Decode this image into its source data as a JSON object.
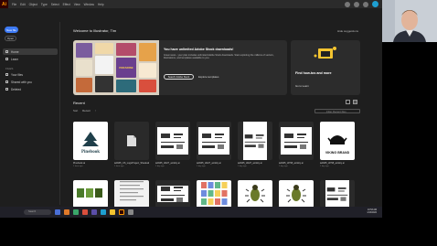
{
  "menubar": {
    "logo": "Ai",
    "items": [
      "File",
      "Edit",
      "Object",
      "Type",
      "Select",
      "Effect",
      "View",
      "Window",
      "Help"
    ]
  },
  "sidebar": {
    "new_file": "New file",
    "open": "Open",
    "items": [
      {
        "label": "Home",
        "icon": "home-icon"
      },
      {
        "label": "Learn",
        "icon": "lightbulb-icon"
      }
    ],
    "files_heading": "FILES",
    "file_items": [
      {
        "label": "Your files",
        "icon": "cloud-icon"
      },
      {
        "label": "Shared with you",
        "icon": "people-icon"
      },
      {
        "label": "Deleted",
        "icon": "trash-icon"
      }
    ]
  },
  "main": {
    "welcome": "Welcome to Illustrator, Tim",
    "hide_suggestions": "Hide suggestions",
    "promo": {
      "title": "You have unlimited Adobe Stock downloads!",
      "body": "Great news - your plan includes unlimited Adobe Stock downloads. Start exploring the millions of vectors, illustrations, and templates available to you.",
      "button": "Search Adobe Stock",
      "link": "Explore templates",
      "collage_text": "PARADISE"
    },
    "discover": {
      "title": "Find how-tos and more",
      "link": "Go to Learn"
    },
    "recent": "Recent",
    "filters": {
      "sort": "Sort",
      "sort_value": "Recent",
      "filter_placeholder": "Filter Recent files"
    },
    "files": [
      {
        "name": "Pinebook.ai",
        "date": "1 hour ago",
        "kind": "pinebook",
        "logo_text": "Pinebook"
      },
      {
        "name": "ia4945_US_LogoProject_ShadesExamples.pdf",
        "date": "1 hour ago",
        "kind": "pdf"
      },
      {
        "name": "ia4945_t4427_activity.ai",
        "date": "1 day ago",
        "kind": "sheet"
      },
      {
        "name": "ia4945_t4427_activity.ai",
        "date": "1 day ago",
        "kind": "sheet2"
      },
      {
        "name": "ia4945_t4427_activity.ai",
        "date": "1 day ago",
        "kind": "doc"
      },
      {
        "name": "ia4945_t4798_activity.ai",
        "date": "1 day ago",
        "kind": "sheet3"
      },
      {
        "name": "ia4945_t4798_activity.ai",
        "date": "1 day ago",
        "kind": "viking",
        "logo_text": "VIKING BRAND"
      }
    ],
    "files_row2": [
      {
        "kind": "green"
      },
      {
        "kind": "text"
      },
      {
        "kind": "sheet"
      },
      {
        "kind": "grid"
      },
      {
        "kind": "bugs"
      },
      {
        "kind": "bugs"
      },
      {
        "kind": "doc"
      }
    ]
  },
  "taskbar": {
    "search": "Search",
    "time": "10:53 AM",
    "date": "1/13/2022"
  },
  "colors": {
    "accent": "#3d7af5",
    "bg": "#1e1e1e",
    "logo_bg": "#310000",
    "logo_fg": "#ff9a00"
  }
}
